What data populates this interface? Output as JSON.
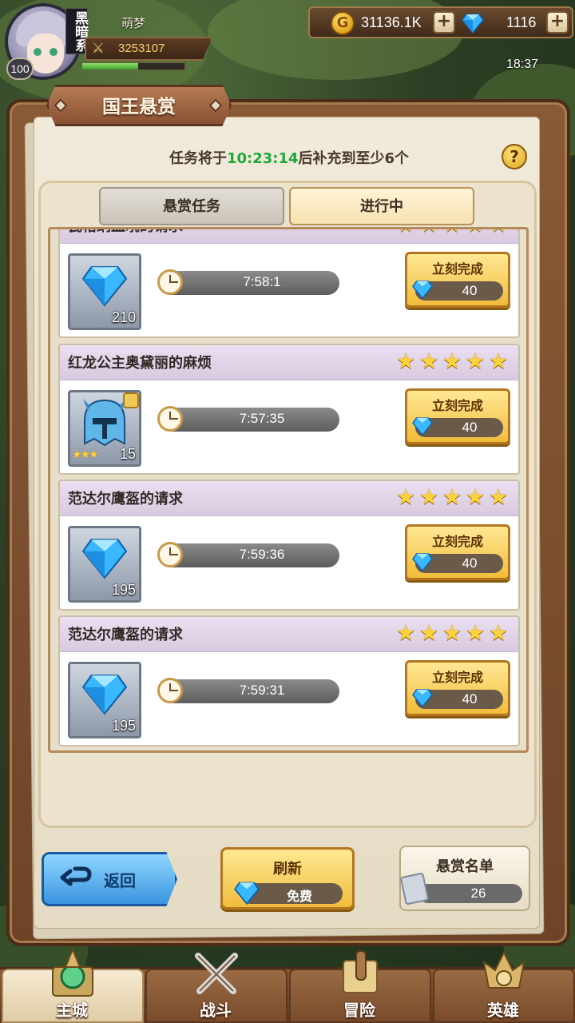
{
  "player": {
    "name": "萌梦",
    "level": "100",
    "vip_tag": "黑暗系",
    "power": "3253107",
    "exp_fraction": 0.55
  },
  "resources": {
    "gold": "31136.1K",
    "gems": "1116"
  },
  "clock": "18:37",
  "panel": {
    "title": "国王悬赏",
    "refill_prefix": "任务将于",
    "refill_time": "10:23:14",
    "refill_suffix": "后补充到至少6个",
    "help": "?"
  },
  "tabs": [
    {
      "label": "悬赏任务",
      "active": false
    },
    {
      "label": "进行中",
      "active": true
    }
  ],
  "tasks": [
    {
      "title": "瓦格纳血吼的请求",
      "stars": 5,
      "reward_icon": "blue-gem-icon",
      "reward_count": "210",
      "timer": "7:58:1",
      "button": "立刻完成",
      "cost": "40"
    },
    {
      "title": "红龙公主奥黛丽的麻烦",
      "stars": 5,
      "reward_icon": "helmet-icon",
      "reward_stars": "★★★",
      "reward_count": "15",
      "timer": "7:57:35",
      "button": "立刻完成",
      "cost": "40"
    },
    {
      "title": "范达尔鹰盔的请求",
      "stars": 5,
      "reward_icon": "blue-gem-icon",
      "reward_count": "195",
      "timer": "7:59:36",
      "button": "立刻完成",
      "cost": "40"
    },
    {
      "title": "范达尔鹰盔的请求",
      "stars": 5,
      "reward_icon": "blue-gem-icon",
      "reward_count": "195",
      "timer": "7:59:31",
      "button": "立刻完成",
      "cost": "40"
    }
  ],
  "footer": {
    "back": "返回",
    "refresh": "刷新",
    "refresh_cost": "免费",
    "bounty_list": "悬赏名单",
    "bounty_count": "26"
  },
  "nav": [
    {
      "label": "主城",
      "icon": "city-icon",
      "active": true
    },
    {
      "label": "战斗",
      "icon": "crossed-swords-icon",
      "active": false
    },
    {
      "label": "冒险",
      "icon": "map-scroll-icon",
      "active": false
    },
    {
      "label": "英雄",
      "icon": "hero-helmet-icon",
      "active": false
    }
  ],
  "colors": {
    "accent_gold": "#f1bc3c",
    "timer_green": "#1fa83a",
    "back_blue": "#3a94e0"
  }
}
